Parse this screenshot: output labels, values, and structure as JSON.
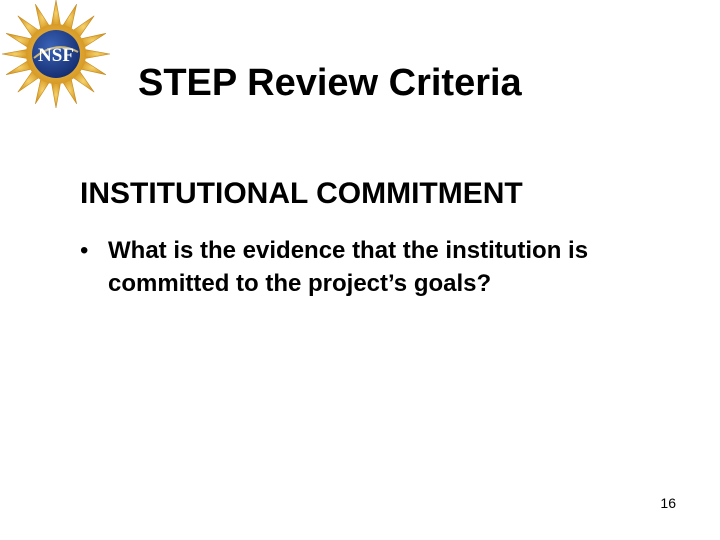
{
  "logo": {
    "text": "NSF"
  },
  "slide": {
    "title": "STEP Review Criteria",
    "heading": "INSTITUTIONAL COMMITMENT",
    "bullets": [
      {
        "marker": "•",
        "text": "What is the evidence that the institution is committed to the project’s goals?"
      }
    ],
    "slide_number": "16"
  },
  "colors": {
    "background": "#ffffff",
    "text": "#000000",
    "logo_gold": "#e8b43a",
    "logo_blue": "#1f3f8f"
  }
}
